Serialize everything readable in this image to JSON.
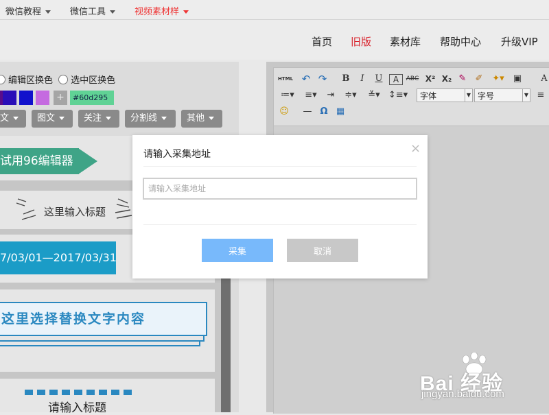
{
  "topbar": {
    "items": [
      {
        "label": "微信教程",
        "active": false
      },
      {
        "label": "微信工具",
        "active": false
      },
      {
        "label": "视频素材样",
        "active": true
      }
    ]
  },
  "mainnav": {
    "items": [
      "首页",
      "旧版",
      "素材库",
      "帮助中心",
      "升级VIP"
    ]
  },
  "leftpanel": {
    "radio_edit_label": "编辑区换色",
    "radio_select_label": "选中区换色",
    "swatch_colors": [
      "#5a0d8a",
      "#2a0fb8",
      "#1111cc",
      "#c56be0",
      "#999999"
    ],
    "add_swatch_label": "+",
    "hex_value": "#60d295",
    "categories": [
      "文",
      "图文",
      "关注",
      "分割线",
      "其他"
    ],
    "preview": {
      "banner_text": "试用96编辑器",
      "title_text": "这里输入标题",
      "date_text": "7/03/01—2017/03/31",
      "replace_text": "这里选择替换文字内容",
      "input_title": "请输入标题"
    }
  },
  "editor": {
    "font_select": "字体",
    "size_select": "字号"
  },
  "dialog": {
    "title": "请输入采集地址",
    "close": "×",
    "input_placeholder": "请输入采集地址",
    "ok_label": "采集",
    "cancel_label": "取消"
  },
  "watermark": {
    "logo_text": "Bai 经验",
    "url_text": "jingyan.baidu.com"
  },
  "colors": {
    "accent_red": "#d9232d",
    "dialog_ok": "#78b9fb",
    "dialog_cancel": "#c8c8c8",
    "banner_green": "#3fa487",
    "date_blue": "#1b9cc7"
  }
}
